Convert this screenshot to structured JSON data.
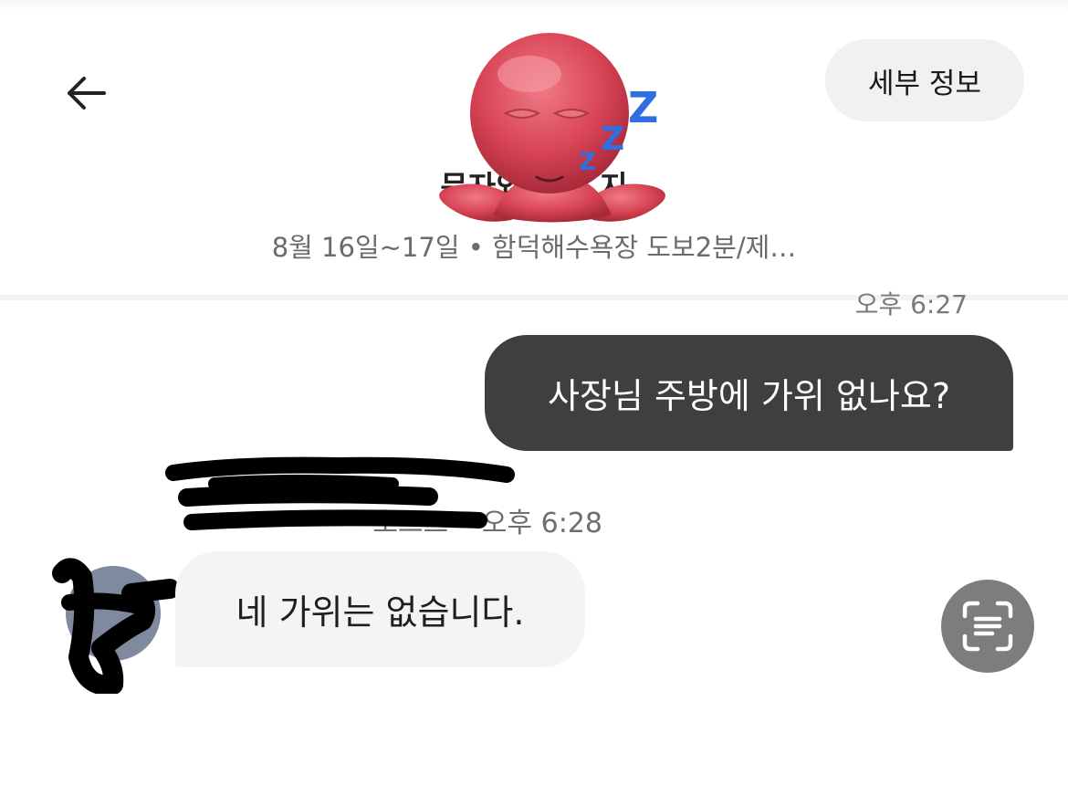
{
  "header": {
    "title": "문자와 날씨 지",
    "subtitle": "8월 16일~17일 • 함덕해수욕장 도보2분/제…",
    "details_label": "세부 정보",
    "back_icon": "arrow-left-icon",
    "sticker": "sleeping-octopus-sticker"
  },
  "messages": {
    "outgoing": {
      "time": "오후 6:27",
      "text": "사장님 주방에 가위 없나요?"
    },
    "incoming": {
      "meta": "호스트 • 오후 6:28",
      "text": "네 가위는 없습니다."
    }
  },
  "scan_icon": "text-scan-icon",
  "colors": {
    "outgoing_bubble": "#3f3f3f",
    "incoming_bubble": "#f4f4f4",
    "scan_button": "#7d7d7d"
  }
}
